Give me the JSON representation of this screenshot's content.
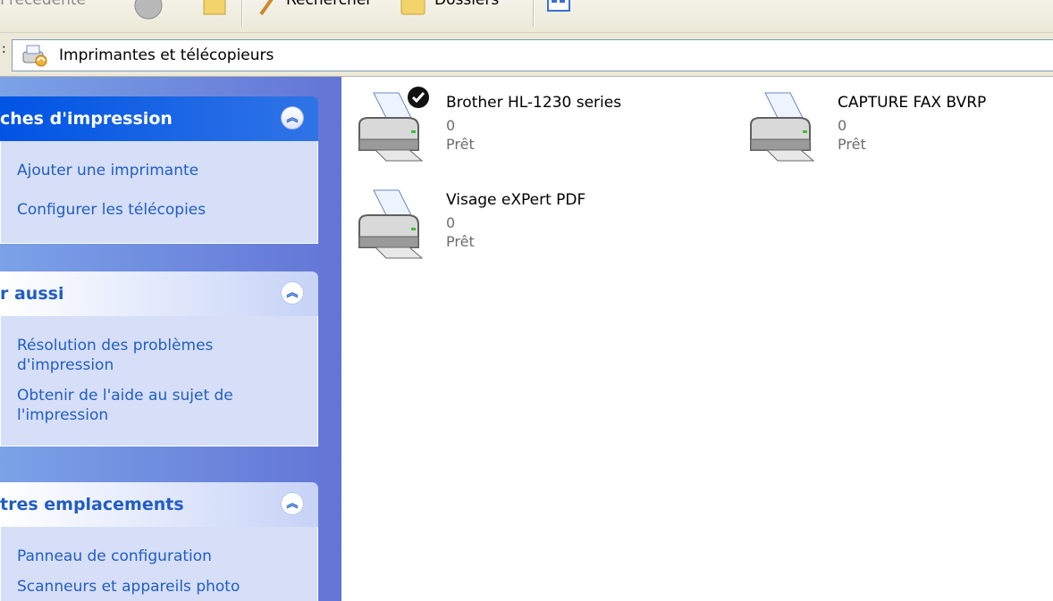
{
  "toolbar": {
    "back_label": "Précédente",
    "search_label": "Rechercher",
    "folders_label": "Dossiers"
  },
  "address": {
    "prefix": ":",
    "path": "Imprimantes et télécopieurs"
  },
  "taskpane": {
    "groups": [
      {
        "title": "ches d'impression",
        "links": [
          "Ajouter une imprimante",
          "Configurer les télécopies"
        ]
      },
      {
        "title": "r aussi",
        "links": [
          "Résolution des problèmes d'impression",
          "Obtenir de l'aide au sujet de l'impression"
        ]
      },
      {
        "title": "tres emplacements",
        "links": [
          "Panneau de configuration",
          "Scanneurs et appareils photo"
        ]
      }
    ]
  },
  "printers": [
    {
      "name": "Brother HL-1230 series",
      "jobs": "0",
      "status": "Prêt",
      "default": true
    },
    {
      "name": "CAPTURE FAX BVRP",
      "jobs": "0",
      "status": "Prêt",
      "default": false
    },
    {
      "name": "Visage eXPert PDF",
      "jobs": "0",
      "status": "Prêt",
      "default": false
    }
  ],
  "colors": {
    "taskpane_bg": "#6375d6",
    "special_header": "#0054e3",
    "link": "#215dc6",
    "body": "#d6dff7"
  }
}
